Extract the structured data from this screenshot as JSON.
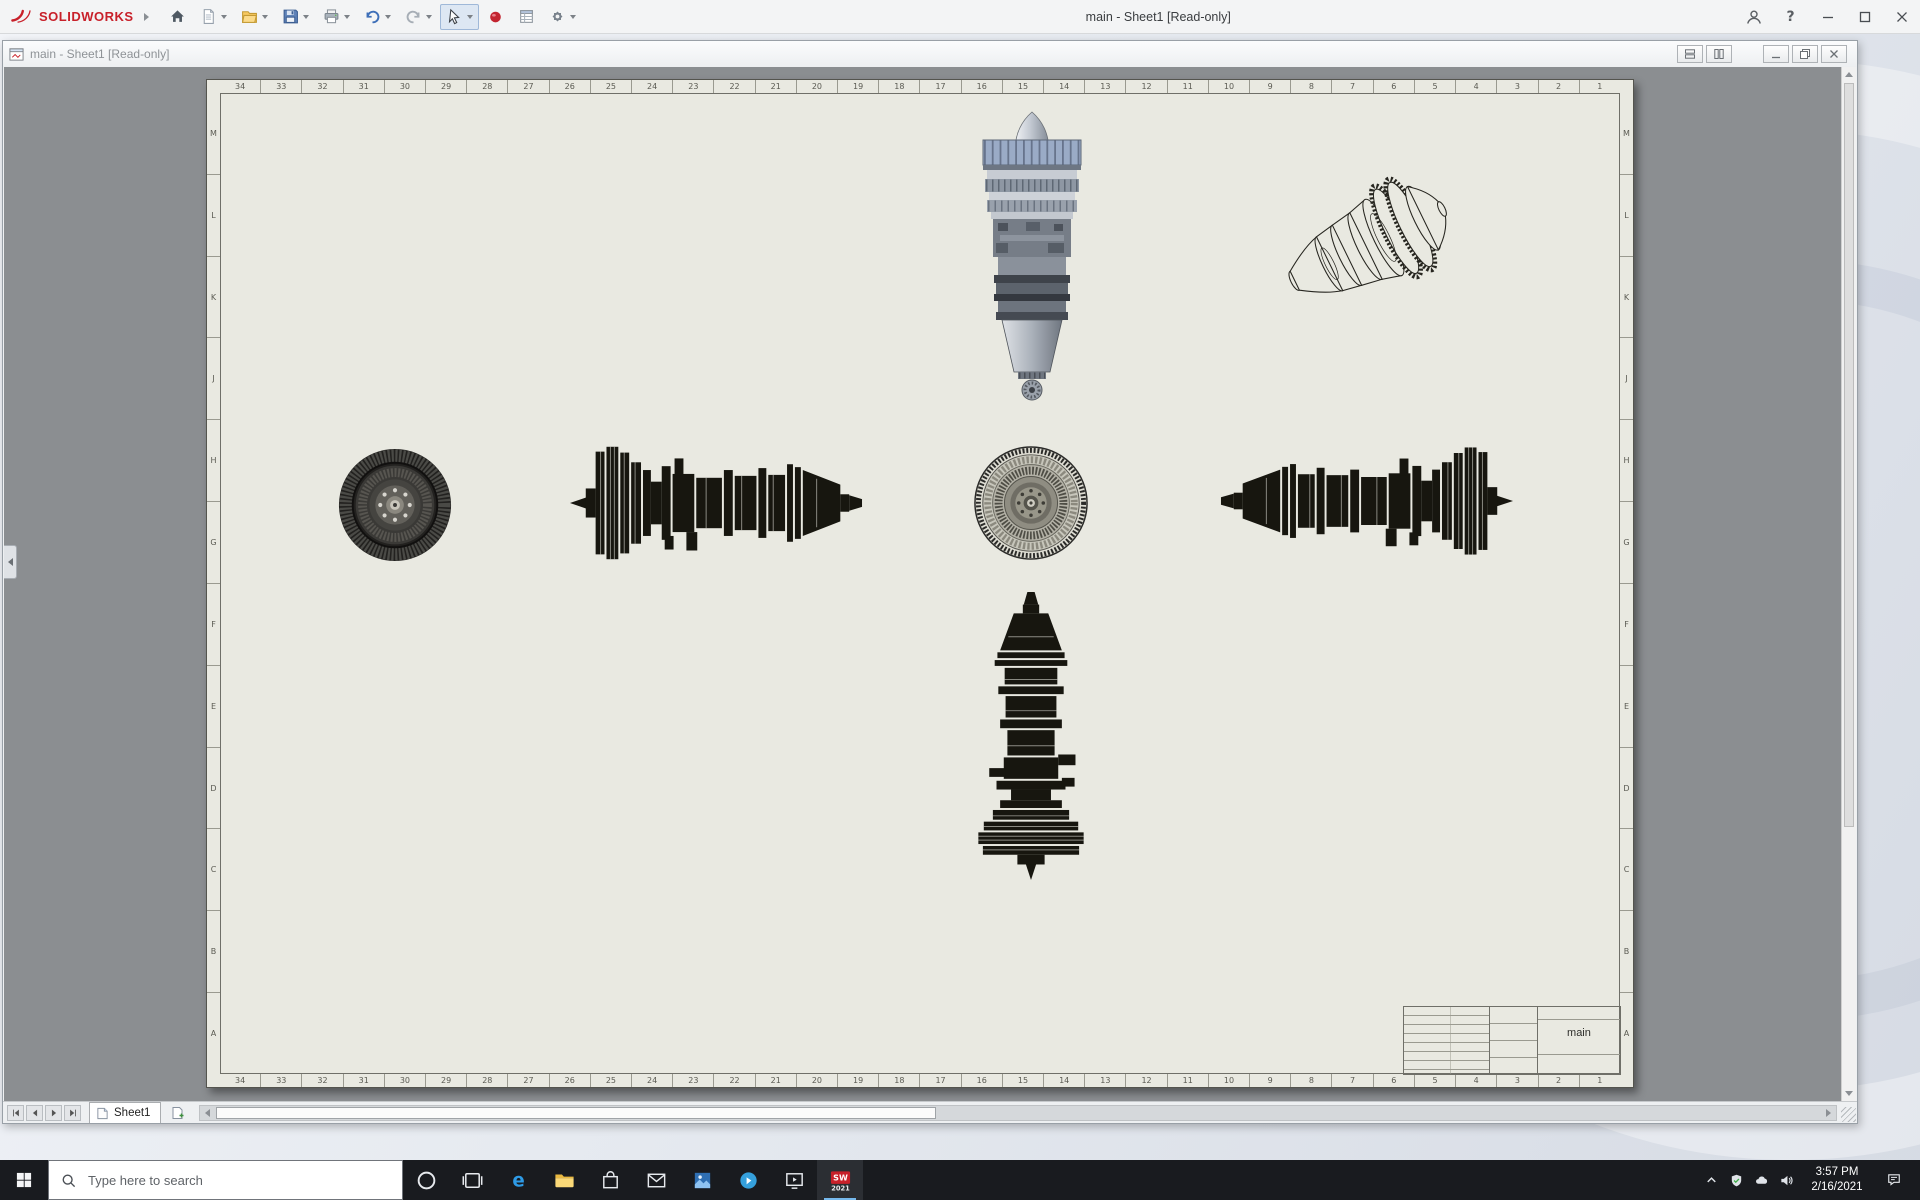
{
  "titlebar": {
    "brand": "SOLIDWORKS",
    "brand_color": "#c8202a",
    "window_title": "main - Sheet1 [Read-only]",
    "help_label": "?",
    "toolbar": [
      {
        "name": "home",
        "icon": "home-icon",
        "dropdown": false,
        "active": false
      },
      {
        "name": "new-document",
        "icon": "new-document-icon",
        "dropdown": true,
        "active": false
      },
      {
        "name": "open",
        "icon": "open-folder-icon",
        "dropdown": true,
        "active": false
      },
      {
        "name": "save",
        "icon": "save-icon",
        "dropdown": true,
        "active": false
      },
      {
        "name": "print",
        "icon": "print-icon",
        "dropdown": true,
        "active": false
      },
      {
        "name": "undo",
        "icon": "undo-icon",
        "dropdown": true,
        "active": false
      },
      {
        "name": "redo",
        "icon": "redo-icon",
        "dropdown": true,
        "active": false
      },
      {
        "name": "select",
        "icon": "select-arrow-icon",
        "dropdown": true,
        "active": true
      },
      {
        "name": "record-macro",
        "icon": "record-macro-icon",
        "dropdown": false,
        "active": false
      },
      {
        "name": "file-properties",
        "icon": "file-properties-icon",
        "dropdown": false,
        "active": false
      },
      {
        "name": "options",
        "icon": "options-gear-icon",
        "dropdown": true,
        "active": false
      }
    ]
  },
  "document_window": {
    "title": "main - Sheet1 [Read-only]"
  },
  "sheet": {
    "zone_columns": [
      "34",
      "33",
      "32",
      "31",
      "30",
      "29",
      "28",
      "27",
      "26",
      "25",
      "24",
      "23",
      "22",
      "21",
      "20",
      "19",
      "18",
      "17",
      "16",
      "15",
      "14",
      "13",
      "12",
      "11",
      "10",
      "9",
      "8",
      "7",
      "6",
      "5",
      "4",
      "3",
      "2",
      "1"
    ],
    "zone_rows": [
      "M",
      "L",
      "K",
      "J",
      "H",
      "G",
      "F",
      "E",
      "D",
      "C",
      "B",
      "A"
    ],
    "title_block": {
      "name": "main"
    }
  },
  "sheet_bar": {
    "tab_label": "Sheet1"
  },
  "taskbar": {
    "search_placeholder": "Type here to search",
    "sw_icon": {
      "top": "SW",
      "bottom": "2021"
    },
    "apps": [
      {
        "name": "cortana",
        "icon": "cortana-icon",
        "active": false
      },
      {
        "name": "task-view",
        "icon": "task-view-icon",
        "active": false
      },
      {
        "name": "edge",
        "icon": "edge-icon",
        "active": false
      },
      {
        "name": "file-explorer",
        "icon": "file-explorer-icon",
        "active": false
      },
      {
        "name": "store",
        "icon": "store-icon",
        "active": false
      },
      {
        "name": "mail",
        "icon": "mail-icon",
        "active": false
      },
      {
        "name": "photos",
        "icon": "photos-icon",
        "active": false
      },
      {
        "name": "media-player",
        "icon": "media-player-icon",
        "active": false
      },
      {
        "name": "movies-tv",
        "icon": "movies-tv-icon",
        "active": false
      },
      {
        "name": "solidworks",
        "icon": "solidworks-taskbar-icon",
        "active": true
      }
    ],
    "tray": [
      {
        "name": "hidden-icons",
        "icon": "tray-expand-icon"
      },
      {
        "name": "security",
        "icon": "security-icon"
      },
      {
        "name": "onedrive",
        "icon": "onedrive-icon"
      },
      {
        "name": "volume",
        "icon": "volume-icon"
      }
    ],
    "clock": {
      "time": "3:57 PM",
      "date": "2/16/2021"
    }
  }
}
